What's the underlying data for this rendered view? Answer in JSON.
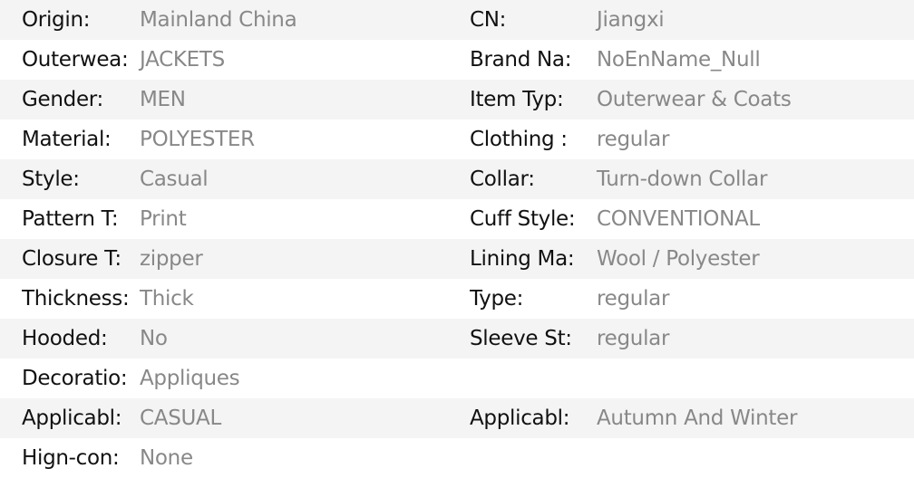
{
  "colors": {
    "label": "#111111",
    "value": "#888888",
    "row_shade": "#f4f4f4"
  },
  "rows": [
    {
      "left": {
        "label": "Origin:",
        "value": "Mainland China"
      },
      "right": {
        "label": "CN:",
        "value": "Jiangxi"
      }
    },
    {
      "left": {
        "label": "Outerwea:",
        "value": "JACKETS"
      },
      "right": {
        "label": "Brand Na:",
        "value": "NoEnName_Null"
      }
    },
    {
      "left": {
        "label": "Gender:",
        "value": "MEN"
      },
      "right": {
        "label": "Item Typ:",
        "value": "Outerwear & Coats"
      }
    },
    {
      "left": {
        "label": "Material:",
        "value": "POLYESTER"
      },
      "right": {
        "label": "Clothing :",
        "value": "regular"
      }
    },
    {
      "left": {
        "label": "Style:",
        "value": "Casual"
      },
      "right": {
        "label": "Collar:",
        "value": "Turn-down Collar"
      }
    },
    {
      "left": {
        "label": "Pattern T:",
        "value": "Print"
      },
      "right": {
        "label": "Cuff Style:",
        "value": "CONVENTIONAL"
      }
    },
    {
      "left": {
        "label": "Closure T:",
        "value": "zipper"
      },
      "right": {
        "label": "Lining Ma:",
        "value": "Wool / Polyester"
      }
    },
    {
      "left": {
        "label": "Thickness:",
        "value": "Thick"
      },
      "right": {
        "label": "Type:",
        "value": "regular"
      }
    },
    {
      "left": {
        "label": "Hooded:",
        "value": "No"
      },
      "right": {
        "label": "Sleeve St:",
        "value": "regular"
      }
    },
    {
      "left": {
        "label": "Decoratio:",
        "value": "Appliques"
      },
      "right": {
        "label": "",
        "value": ""
      }
    },
    {
      "left": {
        "label": "Applicabl:",
        "value": "CASUAL"
      },
      "right": {
        "label": "Applicabl:",
        "value": "Autumn And Winter"
      }
    },
    {
      "left": {
        "label": "Hign-con:",
        "value": "None"
      },
      "right": {
        "label": "",
        "value": ""
      }
    }
  ]
}
